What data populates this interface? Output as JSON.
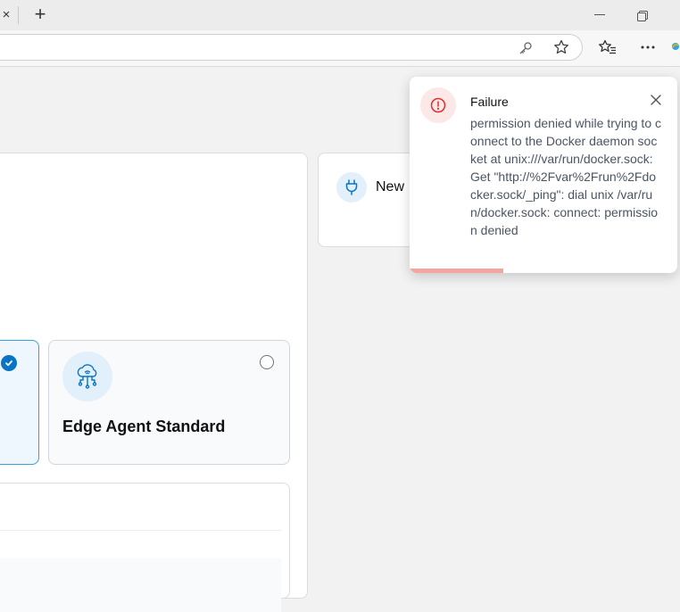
{
  "browser": {
    "tab_close_glyph": "×",
    "new_tab_glyph": "+",
    "icons": [
      "close-icon",
      "plus-icon",
      "minimize-icon",
      "restore-icon",
      "key-icon",
      "star-icon",
      "favorites-icon",
      "more-icon",
      "copilot-icon"
    ]
  },
  "page": {
    "agent_options": [
      {
        "label": "",
        "selected": true
      },
      {
        "label": "Edge Agent Standard",
        "selected": false,
        "icon": "cloud-network-icon"
      }
    ],
    "new_environment": {
      "label": "New",
      "icon": "plug-icon"
    }
  },
  "toast": {
    "type": "error",
    "title": "Failure",
    "message": "permission denied while trying to connect to the Docker daemon socket at unix:///var/run/docker.sock: Get \"http://%2Fvar%2Frun%2Fdocker.sock/_ping\": dial unix /var/run/docker.sock: connect: permission denied",
    "progress": 0.35,
    "icon": "alert-circle-icon"
  },
  "colors": {
    "accent": "#0a74c4",
    "error": "#e02d2d",
    "error_bg": "#fde8e8",
    "progress": "#f4a5a0"
  }
}
